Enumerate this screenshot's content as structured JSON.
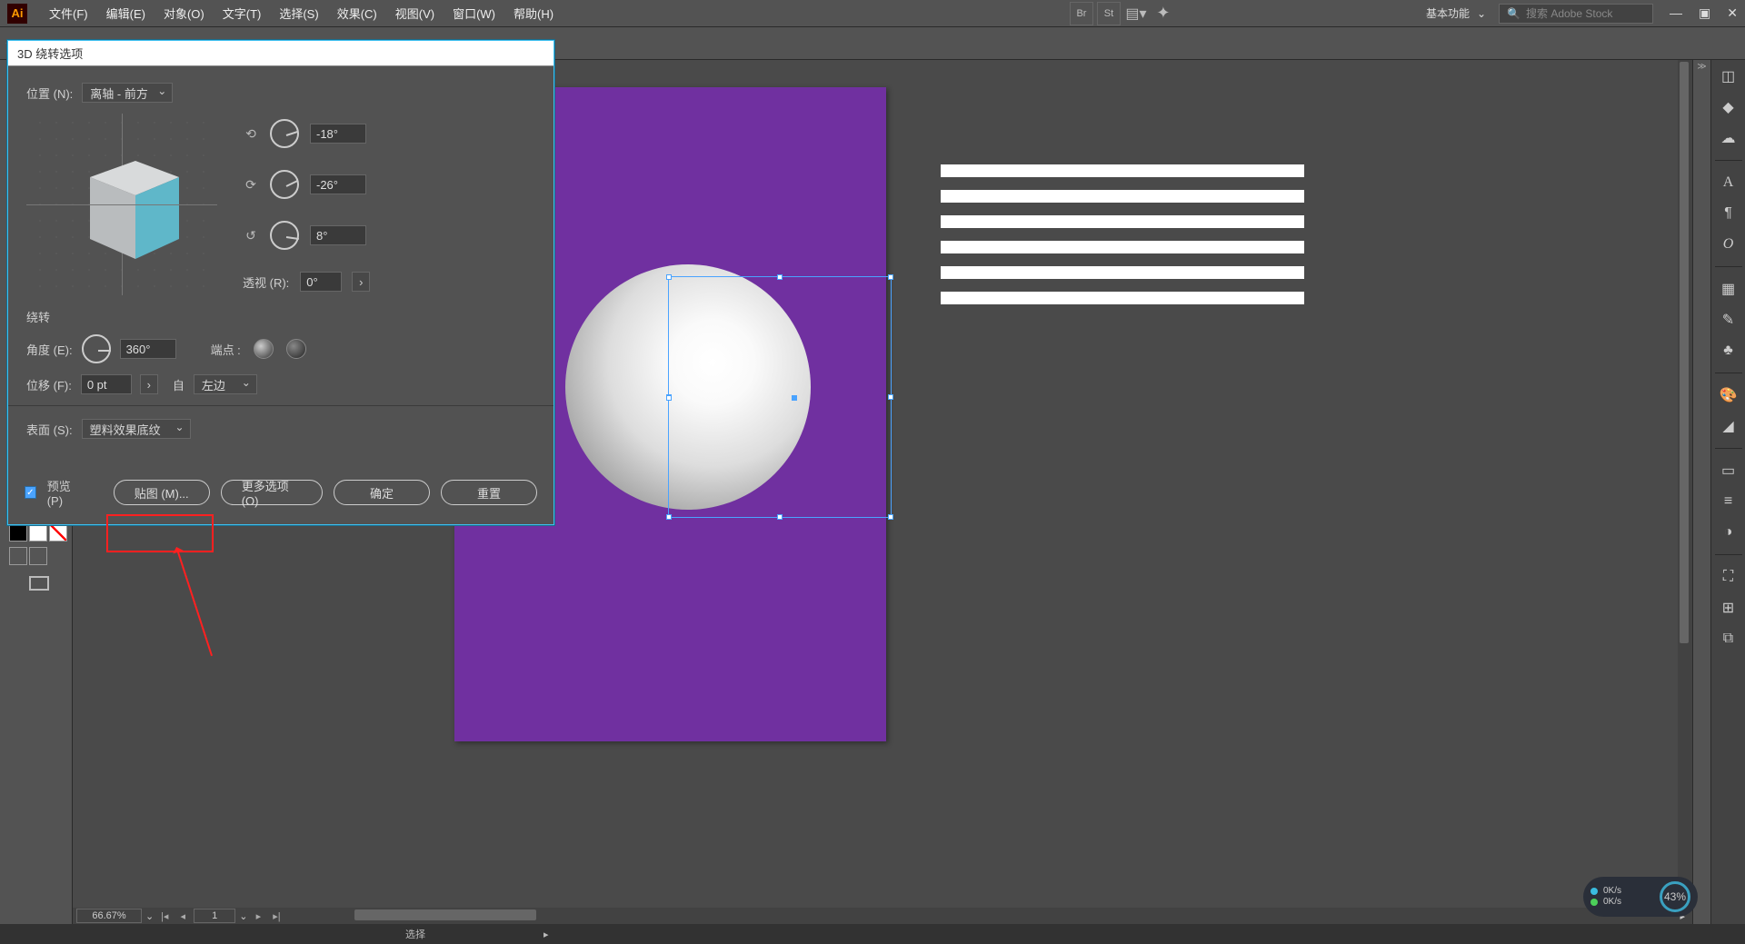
{
  "app": {
    "logo": "Ai"
  },
  "menubar": [
    "文件(F)",
    "编辑(E)",
    "对象(O)",
    "文字(T)",
    "选择(S)",
    "效果(C)",
    "视图(V)",
    "窗口(W)",
    "帮助(H)"
  ],
  "top_icons": {
    "br": "Br",
    "st": "St"
  },
  "workspace": {
    "label": "基本功能"
  },
  "search": {
    "placeholder": "搜索 Adobe Stock"
  },
  "dialog": {
    "title": "3D 绕转选项",
    "position_label": "位置 (N):",
    "position_value": "离轴 - 前方",
    "angle_x": "-18°",
    "angle_y": "-26°",
    "angle_z": "8°",
    "perspective_label": "透视 (R):",
    "perspective_value": "0°",
    "revolve_section": "绕转",
    "angle_label": "角度 (E):",
    "angle_value": "360°",
    "cap_label": "端点 :",
    "offset_label": "位移 (F):",
    "offset_value": "0 pt",
    "from_label": "自",
    "from_value": "左边",
    "surface_label": "表面 (S):",
    "surface_value": "塑料效果底纹",
    "preview_label": "预览 (P)",
    "map_btn": "贴图 (M)...",
    "more_btn": "更多选项 (O)",
    "ok_btn": "确定",
    "reset_btn": "重置"
  },
  "footer": {
    "zoom": "66.67%",
    "artboard_num": "1",
    "tool_label": "选择"
  },
  "netmeter": {
    "up": "0K/s",
    "down": "0K/s",
    "pct": "43%"
  }
}
